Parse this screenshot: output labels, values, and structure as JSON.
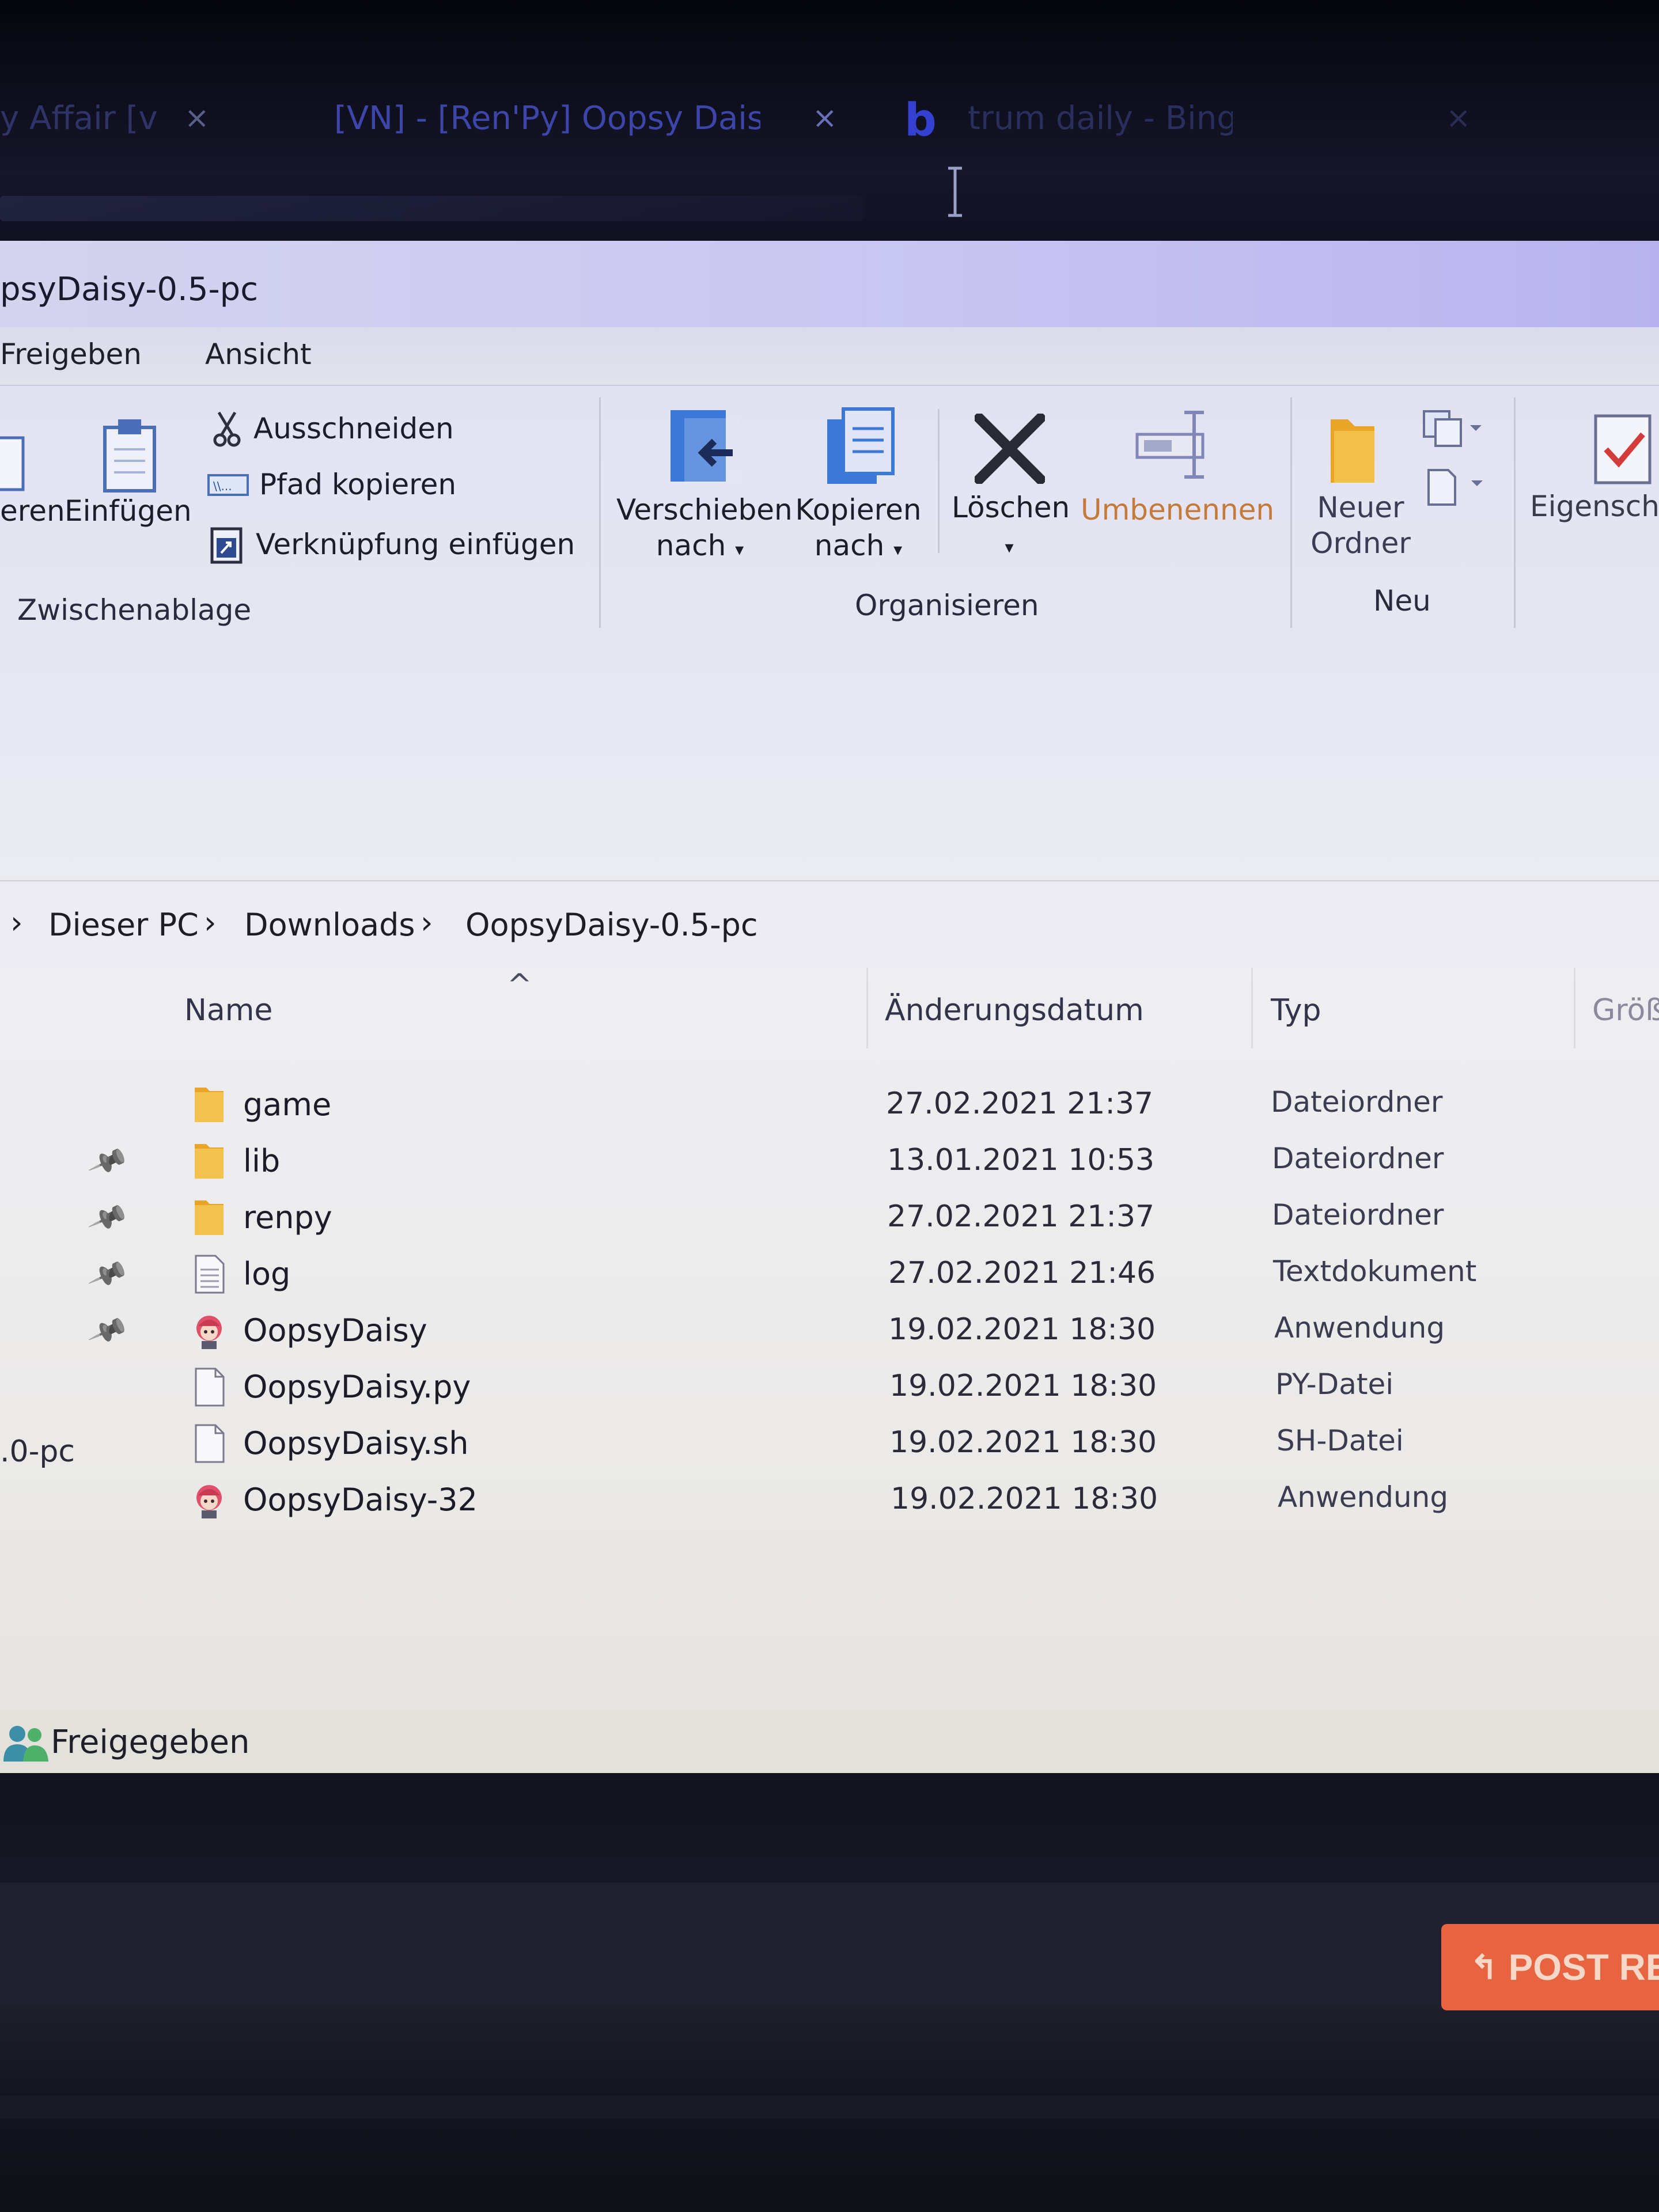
{
  "browser": {
    "tabs": [
      {
        "label": "y Affair [v",
        "close": "×"
      },
      {
        "label": "[VN] - [Ren'Py] Oopsy Daisy [v",
        "close": "×"
      },
      {
        "label": "trum daily - Bing",
        "close": "×"
      }
    ]
  },
  "explorer": {
    "window_title": "psyDaisy-0.5-pc",
    "menu": {
      "freigeben": "Freigeben",
      "ansicht": "Ansicht"
    },
    "ribbon": {
      "clipboard": {
        "partial_label": "eren",
        "paste_label": "Einfügen",
        "cut_label": "Ausschneiden",
        "copy_path_label": "Pfad kopieren",
        "paste_shortcut_label": "Verknüpfung einfügen",
        "group_label": "Zwischenablage"
      },
      "organize": {
        "move_line1": "Verschieben",
        "move_line2": "nach",
        "copy_line1": "Kopieren",
        "copy_line2": "nach",
        "delete_label": "Löschen",
        "rename_label": "Umbenennen",
        "group_label": "Organisieren"
      },
      "new": {
        "new_folder_line1": "Neuer",
        "new_folder_line2": "Ordner",
        "group_label": "Neu"
      },
      "open": {
        "properties_label": "Eigenscha"
      }
    },
    "breadcrumb": [
      "Dieser PC",
      "Downloads",
      "OopsyDaisy-0.5-pc"
    ],
    "columns": {
      "name": "Name",
      "date": "Änderungsdatum",
      "type": "Typ",
      "size": "Größ"
    },
    "files": [
      {
        "name": "game",
        "date": "27.02.2021 21:37",
        "type": "Dateiordner",
        "icon": "folder-icon",
        "pinned": false
      },
      {
        "name": "lib",
        "date": "13.01.2021 10:53",
        "type": "Dateiordner",
        "icon": "folder-icon",
        "pinned": true
      },
      {
        "name": "renpy",
        "date": "27.02.2021 21:37",
        "type": "Dateiordner",
        "icon": "folder-icon",
        "pinned": true
      },
      {
        "name": "log",
        "date": "27.02.2021 21:46",
        "type": "Textdokument",
        "icon": "text-document-icon",
        "pinned": true
      },
      {
        "name": "OopsyDaisy",
        "date": "19.02.2021 18:30",
        "type": "Anwendung",
        "icon": "app-icon",
        "pinned": true
      },
      {
        "name": "OopsyDaisy.py",
        "date": "19.02.2021 18:30",
        "type": "PY-Datei",
        "icon": "blank-file-icon",
        "pinned": false
      },
      {
        "name": "OopsyDaisy.sh",
        "date": "19.02.2021 18:30",
        "type": "SH-Datei",
        "icon": "blank-file-icon",
        "pinned": false
      },
      {
        "name": "OopsyDaisy-32",
        "date": "19.02.2021 18:30",
        "type": "Anwendung",
        "icon": "app-icon",
        "pinned": false
      }
    ],
    "nav_fragment": ".0-pc",
    "status": {
      "label": "Freigegeben"
    }
  },
  "page": {
    "post_reply_label": "POST RE"
  },
  "colors": {
    "accent_orange": "#e8633f",
    "folder_yellow": "#f2c14e",
    "delete_x": "#2a2a36",
    "ribbon_blue": "#3b78d8"
  }
}
